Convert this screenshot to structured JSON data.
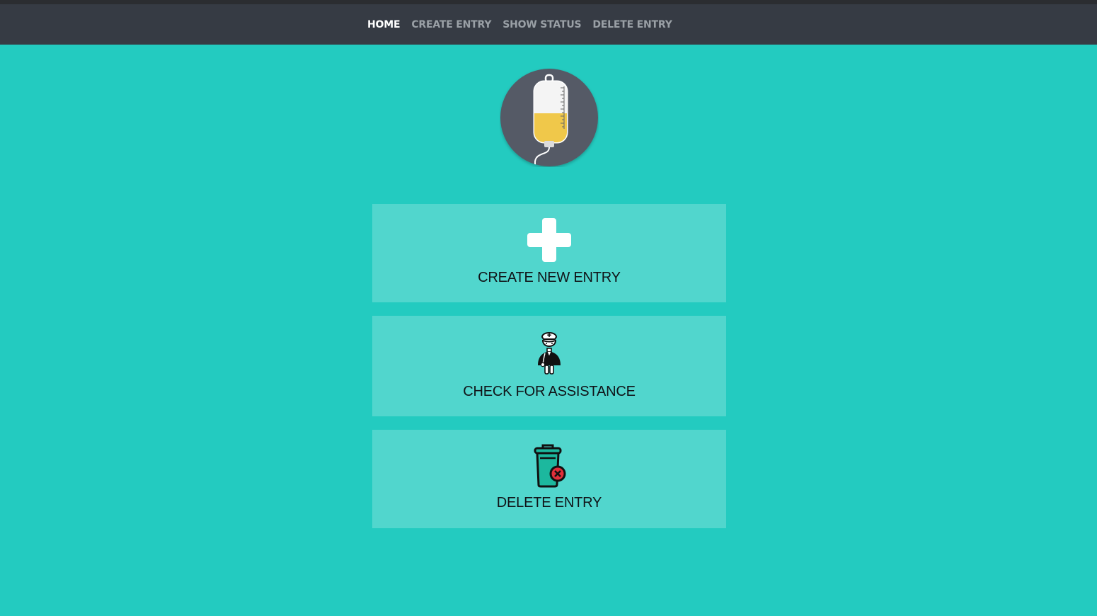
{
  "nav": {
    "items": [
      {
        "label": "HOME",
        "active": true
      },
      {
        "label": "CREATE ENTRY",
        "active": false
      },
      {
        "label": "SHOW STATUS",
        "active": false
      },
      {
        "label": "DELETE ENTRY",
        "active": false
      }
    ]
  },
  "logo": {
    "icon": "iv-drip-bag-icon"
  },
  "cards": [
    {
      "label": "CREATE NEW ENTRY",
      "icon": "plus-icon"
    },
    {
      "label": "CHECK FOR ASSISTANCE",
      "icon": "nurse-icon"
    },
    {
      "label": "DELETE ENTRY",
      "icon": "trash-delete-icon"
    }
  ],
  "colors": {
    "background": "#23cbc0",
    "navbar": "#363b44",
    "card": "#51d6cd",
    "nav_active": "#ffffff",
    "nav_inactive": "#9aa0a6",
    "logo_circle": "#555a66",
    "fluid": "#f0c84a",
    "delete_badge": "#e0303a"
  }
}
